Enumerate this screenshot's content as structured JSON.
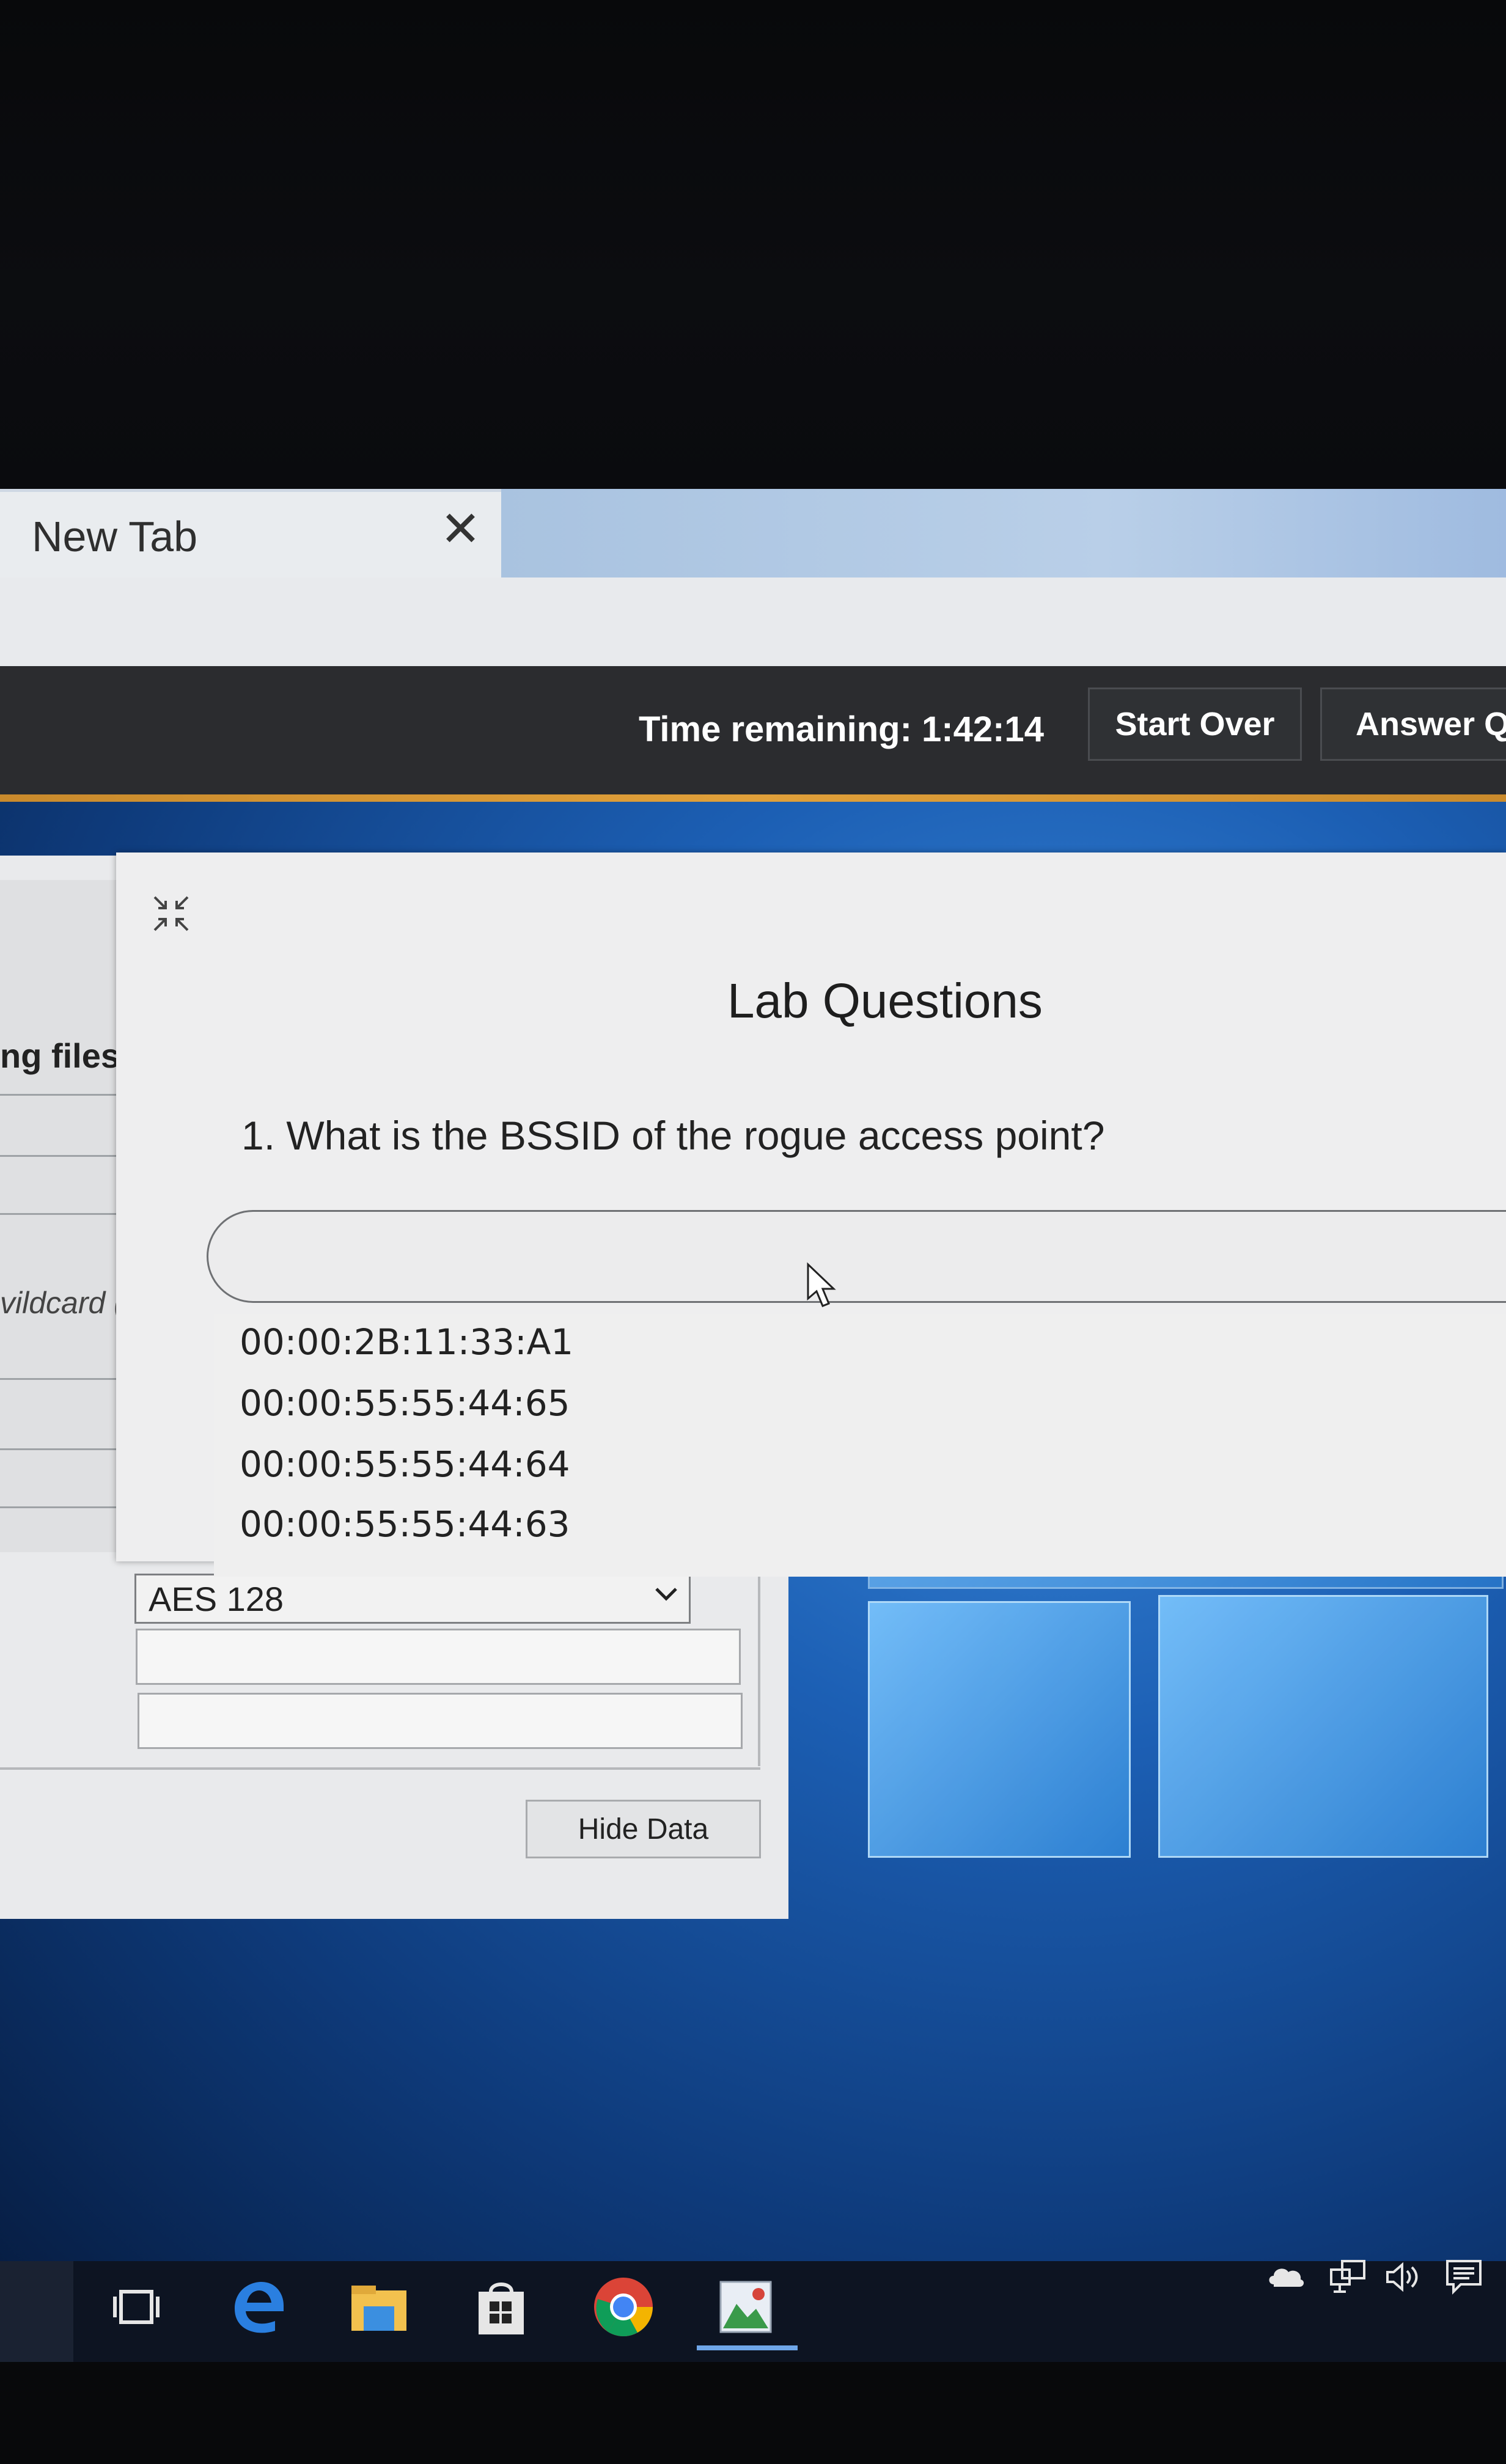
{
  "browser": {
    "tab_title": "New Tab",
    "tab_close_glyph": "✕"
  },
  "lab_header": {
    "time_remaining": "Time remaining: 1:42:14",
    "start_over_label": "Start Over",
    "answer_label": "Answer Qu",
    "accent_color": "#e0a03a"
  },
  "background_app": {
    "files_label": "ng files",
    "wildcard_label": "vildcard (*",
    "encryption_value": "AES 128",
    "hide_data_label": "Hide Data"
  },
  "lab_questions": {
    "title": "Lab Questions",
    "question_1": "1. What is the BSSID of the rogue access point?",
    "options": [
      "00:00:2B:11:33:A1",
      "00:00:55:55:44:65",
      "00:00:55:55:44:64",
      "00:00:55:55:44:63"
    ]
  },
  "taskbar": {
    "icons": [
      "task-view-icon",
      "edge-icon",
      "file-explorer-icon",
      "store-icon",
      "chrome-icon",
      "app-icon"
    ],
    "tray_icons": [
      "cloud-icon",
      "network-icon",
      "volume-icon",
      "notification-icon"
    ]
  }
}
